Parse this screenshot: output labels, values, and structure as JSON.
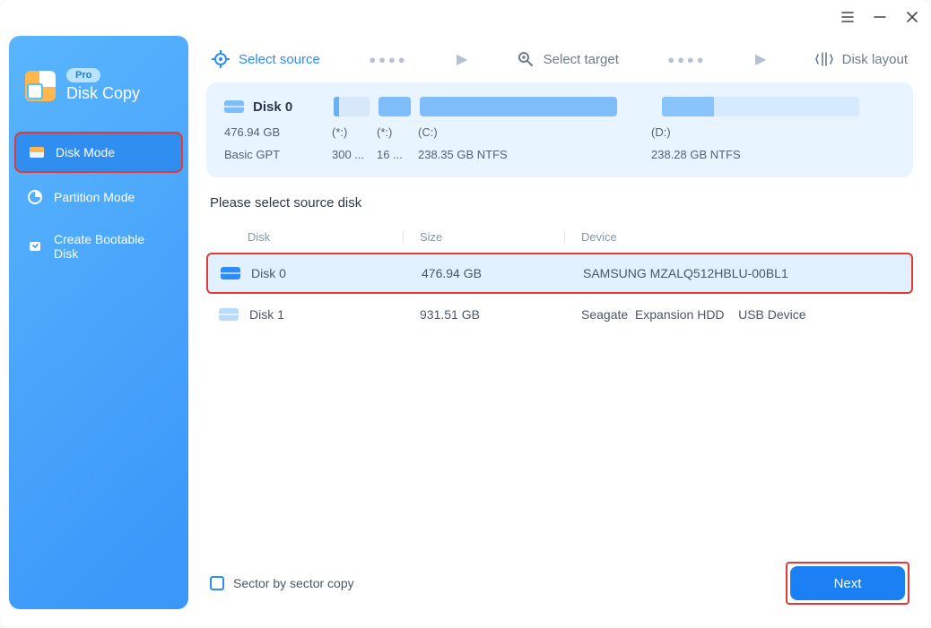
{
  "app": {
    "name": "Disk Copy",
    "badge": "Pro"
  },
  "sidebar": {
    "items": [
      {
        "label": "Disk Mode"
      },
      {
        "label": "Partition Mode"
      },
      {
        "label": "Create Bootable Disk"
      }
    ]
  },
  "steps": {
    "select_source": "Select source",
    "select_target": "Select target",
    "disk_layout": "Disk layout"
  },
  "disk_panel": {
    "title": "Disk 0",
    "size": "476.94 GB",
    "scheme": "Basic GPT",
    "partitions": [
      {
        "letter": "(*:)",
        "label": "300 ..."
      },
      {
        "letter": "(*:)",
        "label": "16 ..."
      },
      {
        "letter": "(C:)",
        "label": "238.35 GB NTFS"
      },
      {
        "letter": "(D:)",
        "label": "238.28 GB NTFS"
      }
    ]
  },
  "section_title": "Please select source disk",
  "headers": {
    "disk": "Disk",
    "size": "Size",
    "device": "Device"
  },
  "disks": [
    {
      "name": "Disk 0",
      "size": "476.94 GB",
      "device": "SAMSUNG MZALQ512HBLU-00BL1"
    },
    {
      "name": "Disk 1",
      "size": "931.51 GB",
      "device": "Seagate  Expansion HDD    USB Device"
    }
  ],
  "footer": {
    "sector_copy": "Sector by sector copy",
    "next": "Next"
  }
}
